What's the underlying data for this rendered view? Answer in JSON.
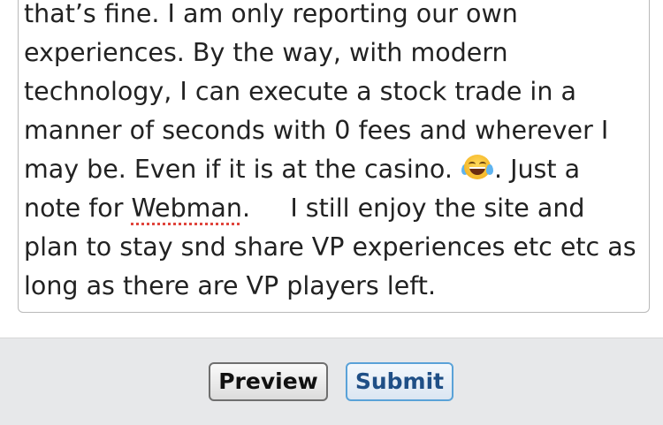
{
  "editor": {
    "lines": [
      "that’s fine. I am only reporting our own",
      "experiences. By the way, with modern",
      "technology, I can execute a stock trade in a",
      "manner of seconds with 0 fees and wherever I",
      "may be. Even if it is at the casino.",
      ". Just a",
      "note for",
      "Webman",
      ".     I still enjoy the site and",
      "plan to stay snd share VP experiences etc etc as",
      "long as there are VP players left."
    ],
    "emoji": "face-with-tears-of-joy",
    "misspelled_word": "Webman"
  },
  "footer": {
    "preview_label": "Preview",
    "submit_label": "Submit"
  },
  "colors": {
    "text": "#222222",
    "footer_background": "#e7e8ea",
    "submit_text": "#1f4f86",
    "submit_border": "#5aa2d8",
    "spellcheck_underline": "#e0453c"
  }
}
